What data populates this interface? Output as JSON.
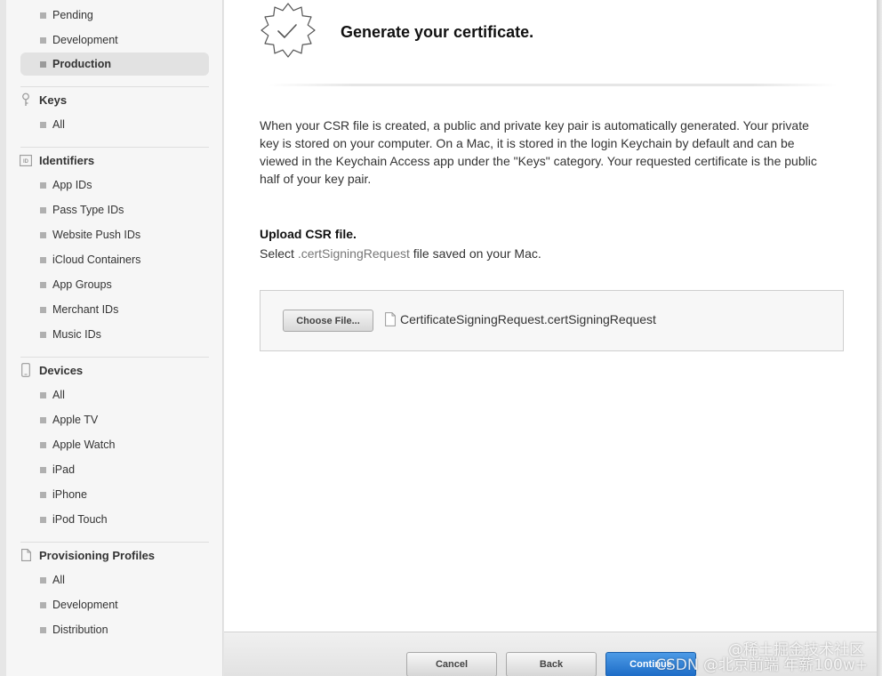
{
  "sidebar": {
    "certificates": {
      "items": [
        {
          "label": "Pending"
        },
        {
          "label": "Development"
        },
        {
          "label": "Production"
        }
      ]
    },
    "keys": {
      "title": "Keys",
      "items": [
        {
          "label": "All"
        }
      ]
    },
    "identifiers": {
      "title": "Identifiers",
      "icon_text": "ID",
      "items": [
        {
          "label": "App IDs"
        },
        {
          "label": "Pass Type IDs"
        },
        {
          "label": "Website Push IDs"
        },
        {
          "label": "iCloud Containers"
        },
        {
          "label": "App Groups"
        },
        {
          "label": "Merchant IDs"
        },
        {
          "label": "Music IDs"
        }
      ]
    },
    "devices": {
      "title": "Devices",
      "items": [
        {
          "label": "All"
        },
        {
          "label": "Apple TV"
        },
        {
          "label": "Apple Watch"
        },
        {
          "label": "iPad"
        },
        {
          "label": "iPhone"
        },
        {
          "label": "iPod Touch"
        }
      ]
    },
    "profiles": {
      "title": "Provisioning Profiles",
      "items": [
        {
          "label": "All"
        },
        {
          "label": "Development"
        },
        {
          "label": "Distribution"
        }
      ]
    },
    "selected": "Production"
  },
  "main": {
    "title": "Generate your certificate.",
    "description": "When your CSR file is created, a public and private key pair is automatically generated. Your private key is stored on your computer. On a Mac, it is stored in the login Keychain by default and can be viewed in the Keychain Access app under the \"Keys\" category. Your requested certificate is the public half of your key pair.",
    "upload": {
      "title": "Upload CSR file.",
      "sub_prefix": "Select ",
      "sub_highlight": ".certSigningRequest",
      "sub_suffix": " file saved on your Mac.",
      "choose_label": "Choose File...",
      "file_name": "CertificateSigningRequest.certSigningRequest"
    }
  },
  "footer": {
    "cancel_label": "Cancel",
    "back_label": "Back",
    "continue_label": "Continue"
  },
  "watermark": {
    "line1": "@稀土掘金技术社区",
    "line2": "CSDN @北京前端 年薪100w+"
  },
  "colors": {
    "accent_blue": "#1d6cc7",
    "sidebar_bg": "#f6f6f6",
    "selected_bg": "#e2e2e2"
  }
}
